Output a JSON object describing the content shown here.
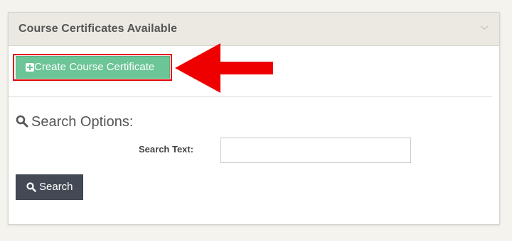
{
  "panel": {
    "title": "Course Certificates Available",
    "collapse_icon": "chevron-down-icon"
  },
  "create_button": {
    "label": "Create Course Certificate",
    "icon": "plus-square-icon",
    "color": "#6cc596"
  },
  "highlight": {
    "outline_color": "#e00000",
    "arrow_color": "#ee0000",
    "arrow_icon": "left-arrow-icon"
  },
  "search": {
    "heading": "Search Options:",
    "heading_icon": "search-icon",
    "text_label": "Search Text:",
    "text_value": "",
    "button_label": "Search",
    "button_icon": "search-icon",
    "button_color": "#444a55"
  }
}
